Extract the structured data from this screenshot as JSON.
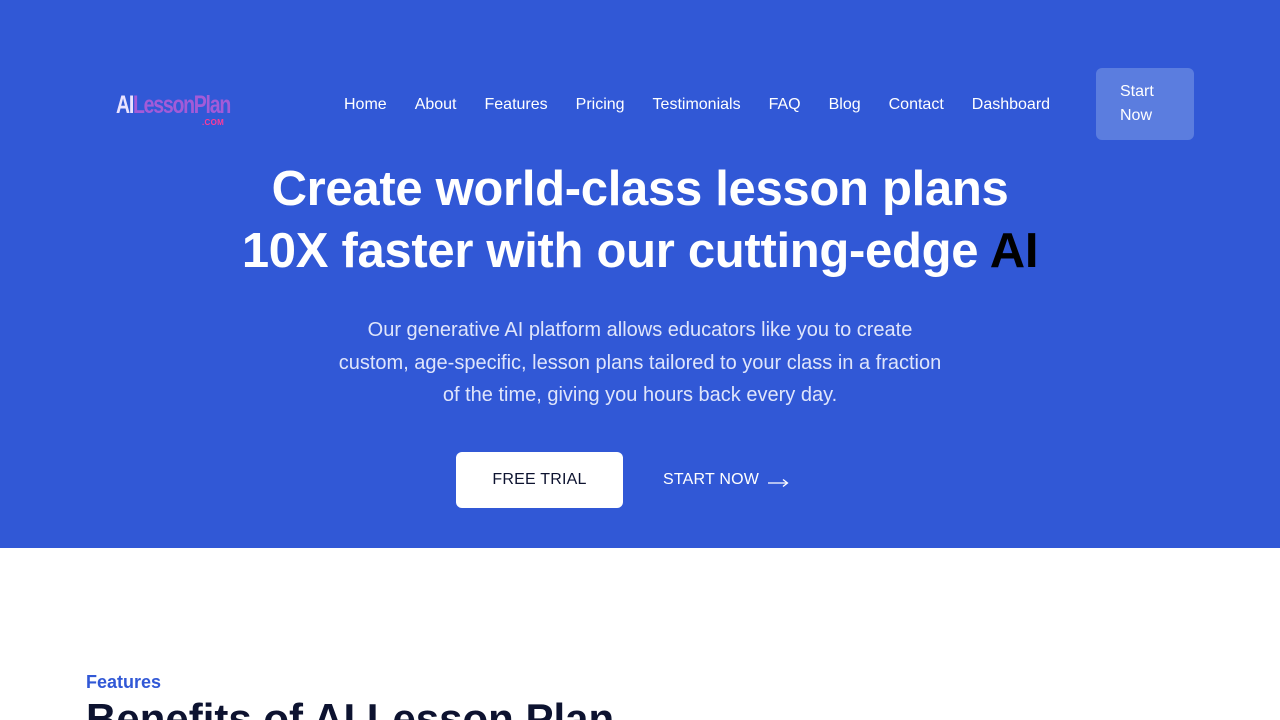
{
  "logo": {
    "ai": "AI",
    "name": "LessonPlan",
    "suffix": ".COM"
  },
  "nav": {
    "items": [
      "Home",
      "About",
      "Features",
      "Pricing",
      "Testimonials",
      "FAQ",
      "Blog",
      "Contact",
      "Dashboard"
    ]
  },
  "header": {
    "start_button": "Start Now"
  },
  "hero": {
    "headline_line1": "Create world-class lesson plans",
    "headline_line2": "10X faster with our cutting-edge",
    "headline_accent": "AI",
    "subtext": "Our generative AI platform allows educators like you to create custom, age-specific, lesson plans tailored to your class in a fraction of the time, giving you hours back every day.",
    "free_trial_label": "FREE TRIAL",
    "start_now_label": "START NOW"
  },
  "features": {
    "label": "Features",
    "title": "Benefits of AI Lesson Plan"
  },
  "colors": {
    "hero_background": "#3158d6",
    "start_button": "#5b7ddf",
    "accent_text": "#000000",
    "features_label": "#3158d6",
    "heading_dark": "#0d1330"
  },
  "icons": {
    "cta_arrow": "long-arrow-right-icon"
  }
}
